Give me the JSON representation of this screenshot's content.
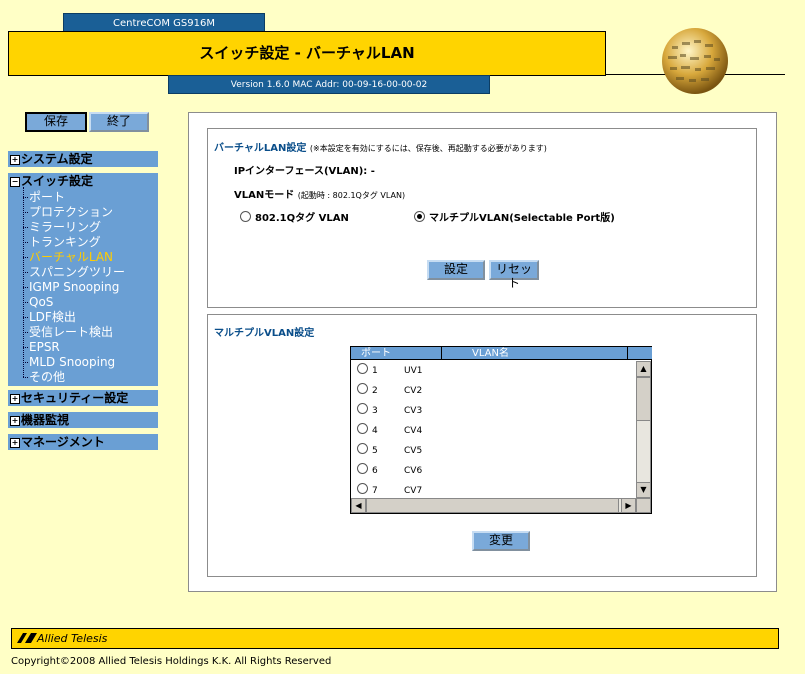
{
  "header": {
    "model": "CentreCOM GS916M",
    "title": "スイッチ設定 - バーチャルLAN",
    "version": "Version 1.6.0 MAC Addr: 00-09-16-00-00-02"
  },
  "toolbar": {
    "save_label": "保存",
    "exit_label": "終了"
  },
  "nav": {
    "system": "システム設定",
    "switch": "スイッチ設定",
    "switch_items": [
      "ポート",
      "プロテクション",
      "ミラーリング",
      "トランキング",
      "バーチャルLAN",
      "スパニングツリー",
      "IGMP Snooping",
      "QoS",
      "LDF検出",
      "受信レート検出",
      "EPSR",
      "MLD Snooping",
      "その他"
    ],
    "active_item": "バーチャルLAN",
    "security": "セキュリティー設定",
    "monitor": "機器監視",
    "management": "マネージメント"
  },
  "vlan_settings": {
    "title": "バーチャルLAN設定",
    "note": "(※本設定を有効にするには、保存後、再起動する必要があります)",
    "ip_interface": "IPインターフェース(VLAN): -",
    "mode_label": "VLANモード",
    "mode_note": "(起動時 : 802.1Qタグ VLAN)",
    "option_tag": "802.1Qタグ VLAN",
    "option_multiple": "マルチプルVLAN(Selectable Port版)",
    "selected": "multiple",
    "set_button": "設定",
    "reset_button": "リセット"
  },
  "multiple_vlan": {
    "title": "マルチプルVLAN設定",
    "col_port": "ポート",
    "col_name": "VLAN名",
    "rows": [
      {
        "port": "1",
        "name": "UV1"
      },
      {
        "port": "2",
        "name": "CV2"
      },
      {
        "port": "3",
        "name": "CV3"
      },
      {
        "port": "4",
        "name": "CV4"
      },
      {
        "port": "5",
        "name": "CV5"
      },
      {
        "port": "6",
        "name": "CV6"
      },
      {
        "port": "7",
        "name": "CV7"
      }
    ],
    "change_button": "変更"
  },
  "footer": {
    "brand": "Allied Telesis",
    "copyright": "Copyright©2008 Allied Telesis Holdings K.K. All Rights Reserved"
  },
  "colors": {
    "accent_yellow": "#ffd400",
    "nav_blue": "#6a9fd4",
    "header_blue": "#1a5f96",
    "page_bg": "#ffffc6"
  }
}
